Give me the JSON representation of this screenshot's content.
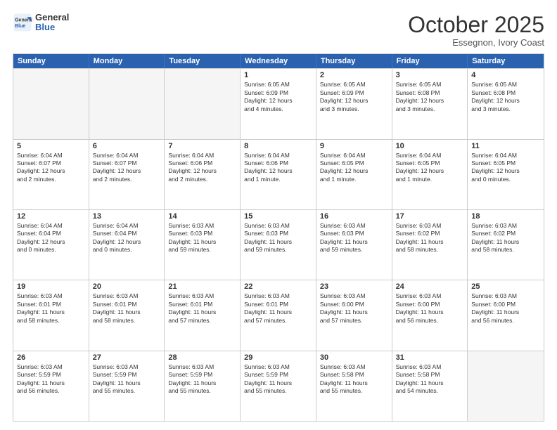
{
  "header": {
    "logo_line1": "General",
    "logo_line2": "Blue",
    "month": "October 2025",
    "location": "Essegnon, Ivory Coast"
  },
  "weekdays": [
    "Sunday",
    "Monday",
    "Tuesday",
    "Wednesday",
    "Thursday",
    "Friday",
    "Saturday"
  ],
  "rows": [
    [
      {
        "day": "",
        "info": ""
      },
      {
        "day": "",
        "info": ""
      },
      {
        "day": "",
        "info": ""
      },
      {
        "day": "1",
        "info": "Sunrise: 6:05 AM\nSunset: 6:09 PM\nDaylight: 12 hours\nand 4 minutes."
      },
      {
        "day": "2",
        "info": "Sunrise: 6:05 AM\nSunset: 6:09 PM\nDaylight: 12 hours\nand 3 minutes."
      },
      {
        "day": "3",
        "info": "Sunrise: 6:05 AM\nSunset: 6:08 PM\nDaylight: 12 hours\nand 3 minutes."
      },
      {
        "day": "4",
        "info": "Sunrise: 6:05 AM\nSunset: 6:08 PM\nDaylight: 12 hours\nand 3 minutes."
      }
    ],
    [
      {
        "day": "5",
        "info": "Sunrise: 6:04 AM\nSunset: 6:07 PM\nDaylight: 12 hours\nand 2 minutes."
      },
      {
        "day": "6",
        "info": "Sunrise: 6:04 AM\nSunset: 6:07 PM\nDaylight: 12 hours\nand 2 minutes."
      },
      {
        "day": "7",
        "info": "Sunrise: 6:04 AM\nSunset: 6:06 PM\nDaylight: 12 hours\nand 2 minutes."
      },
      {
        "day": "8",
        "info": "Sunrise: 6:04 AM\nSunset: 6:06 PM\nDaylight: 12 hours\nand 1 minute."
      },
      {
        "day": "9",
        "info": "Sunrise: 6:04 AM\nSunset: 6:05 PM\nDaylight: 12 hours\nand 1 minute."
      },
      {
        "day": "10",
        "info": "Sunrise: 6:04 AM\nSunset: 6:05 PM\nDaylight: 12 hours\nand 1 minute."
      },
      {
        "day": "11",
        "info": "Sunrise: 6:04 AM\nSunset: 6:05 PM\nDaylight: 12 hours\nand 0 minutes."
      }
    ],
    [
      {
        "day": "12",
        "info": "Sunrise: 6:04 AM\nSunset: 6:04 PM\nDaylight: 12 hours\nand 0 minutes."
      },
      {
        "day": "13",
        "info": "Sunrise: 6:04 AM\nSunset: 6:04 PM\nDaylight: 12 hours\nand 0 minutes."
      },
      {
        "day": "14",
        "info": "Sunrise: 6:03 AM\nSunset: 6:03 PM\nDaylight: 11 hours\nand 59 minutes."
      },
      {
        "day": "15",
        "info": "Sunrise: 6:03 AM\nSunset: 6:03 PM\nDaylight: 11 hours\nand 59 minutes."
      },
      {
        "day": "16",
        "info": "Sunrise: 6:03 AM\nSunset: 6:03 PM\nDaylight: 11 hours\nand 59 minutes."
      },
      {
        "day": "17",
        "info": "Sunrise: 6:03 AM\nSunset: 6:02 PM\nDaylight: 11 hours\nand 58 minutes."
      },
      {
        "day": "18",
        "info": "Sunrise: 6:03 AM\nSunset: 6:02 PM\nDaylight: 11 hours\nand 58 minutes."
      }
    ],
    [
      {
        "day": "19",
        "info": "Sunrise: 6:03 AM\nSunset: 6:01 PM\nDaylight: 11 hours\nand 58 minutes."
      },
      {
        "day": "20",
        "info": "Sunrise: 6:03 AM\nSunset: 6:01 PM\nDaylight: 11 hours\nand 58 minutes."
      },
      {
        "day": "21",
        "info": "Sunrise: 6:03 AM\nSunset: 6:01 PM\nDaylight: 11 hours\nand 57 minutes."
      },
      {
        "day": "22",
        "info": "Sunrise: 6:03 AM\nSunset: 6:01 PM\nDaylight: 11 hours\nand 57 minutes."
      },
      {
        "day": "23",
        "info": "Sunrise: 6:03 AM\nSunset: 6:00 PM\nDaylight: 11 hours\nand 57 minutes."
      },
      {
        "day": "24",
        "info": "Sunrise: 6:03 AM\nSunset: 6:00 PM\nDaylight: 11 hours\nand 56 minutes."
      },
      {
        "day": "25",
        "info": "Sunrise: 6:03 AM\nSunset: 6:00 PM\nDaylight: 11 hours\nand 56 minutes."
      }
    ],
    [
      {
        "day": "26",
        "info": "Sunrise: 6:03 AM\nSunset: 5:59 PM\nDaylight: 11 hours\nand 56 minutes."
      },
      {
        "day": "27",
        "info": "Sunrise: 6:03 AM\nSunset: 5:59 PM\nDaylight: 11 hours\nand 55 minutes."
      },
      {
        "day": "28",
        "info": "Sunrise: 6:03 AM\nSunset: 5:59 PM\nDaylight: 11 hours\nand 55 minutes."
      },
      {
        "day": "29",
        "info": "Sunrise: 6:03 AM\nSunset: 5:59 PM\nDaylight: 11 hours\nand 55 minutes."
      },
      {
        "day": "30",
        "info": "Sunrise: 6:03 AM\nSunset: 5:58 PM\nDaylight: 11 hours\nand 55 minutes."
      },
      {
        "day": "31",
        "info": "Sunrise: 6:03 AM\nSunset: 5:58 PM\nDaylight: 11 hours\nand 54 minutes."
      },
      {
        "day": "",
        "info": ""
      }
    ]
  ]
}
